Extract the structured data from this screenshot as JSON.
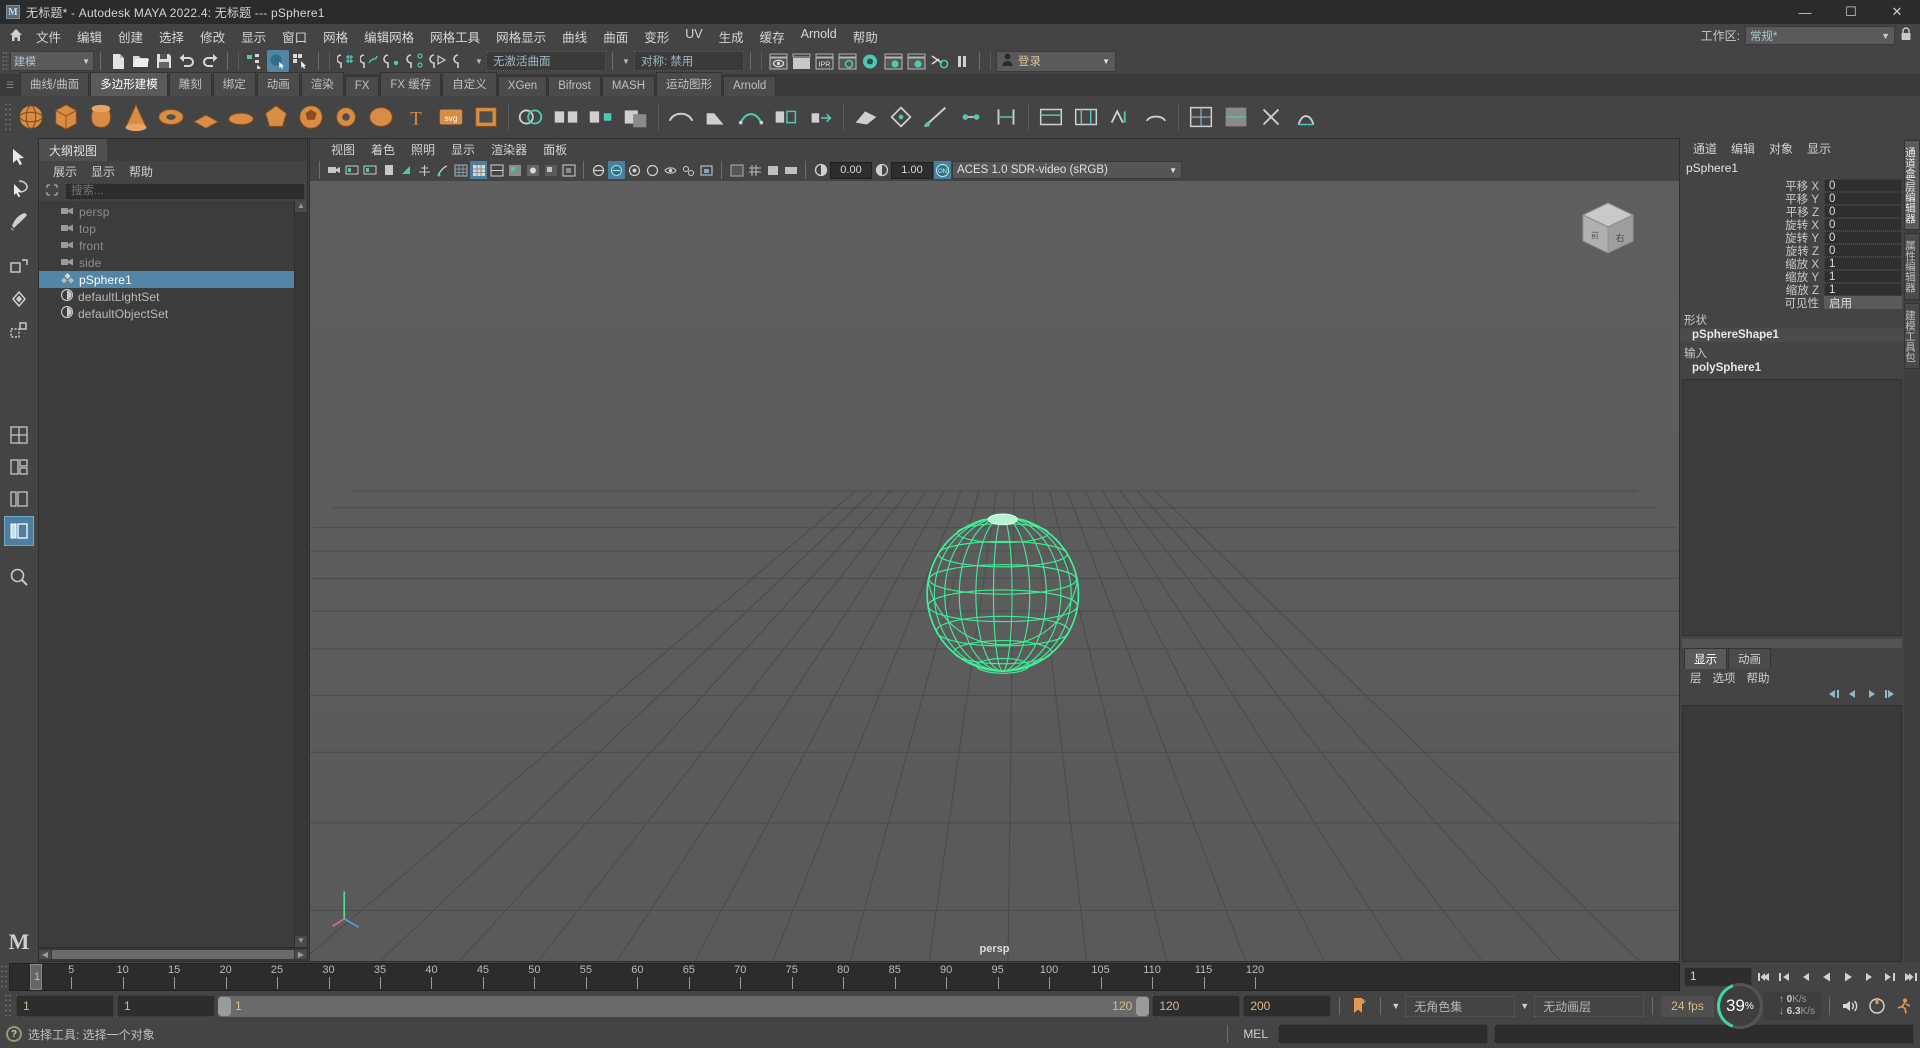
{
  "window": {
    "title": "无标题* - Autodesk MAYA 2022.4: 无标题   ---   pSphere1",
    "minimize": "—",
    "maximize": "☐",
    "close": "✕",
    "app_icon": "maya-logo-icon"
  },
  "menubar": {
    "home_icon": "home-icon",
    "items": [
      "文件",
      "编辑",
      "创建",
      "选择",
      "修改",
      "显示",
      "窗口",
      "网格",
      "编辑网格",
      "网格工具",
      "网格显示",
      "曲线",
      "曲面",
      "变形",
      "UV",
      "生成",
      "缓存",
      "Arnold",
      "帮助"
    ],
    "workspace_label": "工作区:",
    "workspace_value": "常规*",
    "lock_icon": "lock-icon"
  },
  "statusline": {
    "mode_value": "建模",
    "surface_field": "无激活曲面",
    "symmetry_field": "对称: 禁用",
    "login_label": "登录",
    "icons": [
      "new-file-icon",
      "open-file-icon",
      "save-file-icon",
      "undo-icon",
      "redo-icon",
      "select-hierarchy-icon",
      "select-object-icon",
      "select-component-icon",
      "snap-grid-icon",
      "snap-curve-icon",
      "snap-point-icon",
      "snap-projected-icon",
      "snap-view-plane-icon",
      "render-view-icon",
      "render-region-icon",
      "ipr-icon",
      "render-settings-icon",
      "hypershade-icon",
      "render-setup-icon",
      "light-editor-icon",
      "toggle-render-icon",
      "pause-icon",
      "user-avatar-icon"
    ]
  },
  "shelf": {
    "tabs": [
      "曲线/曲面",
      "多边形建模",
      "雕刻",
      "绑定",
      "动画",
      "渲染",
      "FX",
      "FX 缓存",
      "自定义",
      "XGen",
      "Bifrost",
      "MASH",
      "运动图形",
      "Arnold"
    ],
    "active_tab": "多边形建模",
    "icon_names": [
      "poly-sphere",
      "poly-cube",
      "poly-cylinder",
      "poly-cone",
      "poly-torus",
      "poly-plane",
      "poly-disc",
      "poly-platonic",
      "poly-soccer-ball",
      "poly-gear",
      "poly-super-ellipse",
      "poly-type",
      "poly-svg",
      "poly-pipe",
      "combine",
      "separate",
      "extract",
      "booleans",
      "smooth",
      "bevel",
      "bridge",
      "append-poly",
      "extrude",
      "wedge",
      "poke",
      "multi-cut",
      "target-weld",
      "connect",
      "offset-edge-loop",
      "insert-edge-loop",
      "slide-edge",
      "crease",
      "uv-editor",
      "uv-mapping",
      "uv-cut",
      "uv-sew"
    ]
  },
  "toolbox": {
    "items": [
      "select-tool",
      "lasso-select-tool",
      "paint-select-tool",
      "move-tool",
      "rotate-tool",
      "scale-tool",
      "soft-select-tool",
      "last-tool",
      "layout-single-icon",
      "layout-two-pane-icon",
      "layout-three-pane-icon",
      "outliner-persp-layout-icon",
      "hypergraph-layout-icon"
    ],
    "active": "outliner-persp-layout-icon",
    "logo": "maya-M-logo"
  },
  "outliner": {
    "title": "大纲视图",
    "menus": [
      "展示",
      "显示",
      "帮助"
    ],
    "search_icon": "filter-icon",
    "search_placeholder": "搜索...",
    "items": [
      {
        "name": "persp",
        "icon": "camera-icon",
        "selected": false,
        "dim": true
      },
      {
        "name": "top",
        "icon": "camera-icon",
        "selected": false,
        "dim": true
      },
      {
        "name": "front",
        "icon": "camera-icon",
        "selected": false,
        "dim": true
      },
      {
        "name": "side",
        "icon": "camera-icon",
        "selected": false,
        "dim": true
      },
      {
        "name": "pSphere1",
        "icon": "transform-icon",
        "selected": true,
        "dim": false
      },
      {
        "name": "defaultLightSet",
        "icon": "set-icon",
        "selected": false,
        "dim": false
      },
      {
        "name": "defaultObjectSet",
        "icon": "set-icon",
        "selected": false,
        "dim": false
      }
    ]
  },
  "viewport": {
    "menus": [
      "视图",
      "着色",
      "照明",
      "显示",
      "渲染器",
      "面板"
    ],
    "exposure_value": "0.00",
    "gamma_value": "1.00",
    "colorspace": "ACES 1.0 SDR-video (sRGB)",
    "camera_label": "persp",
    "view_cube_icon": "view-cube-icon",
    "axis_gizmo_icon": "axis-gizmo-icon",
    "object": {
      "type": "sphere-wireframe",
      "selected": true,
      "wire_color": "#3ff29a",
      "highlight_color": "#b6f2d2"
    },
    "grid_color": "#4a4a4a",
    "bg_color": "#5d5d5d"
  },
  "channelbox": {
    "menus": [
      "通道",
      "编辑",
      "对象",
      "显示"
    ],
    "object_name": "pSphere1",
    "attributes": [
      {
        "label": "平移 X",
        "value": "0",
        "grey": false
      },
      {
        "label": "平移 Y",
        "value": "0",
        "grey": false
      },
      {
        "label": "平移 Z",
        "value": "0",
        "grey": false
      },
      {
        "label": "旋转 X",
        "value": "0",
        "grey": false
      },
      {
        "label": "旋转 Y",
        "value": "0",
        "grey": false
      },
      {
        "label": "旋转 Z",
        "value": "0",
        "grey": false
      },
      {
        "label": "缩放 X",
        "value": "1",
        "grey": false
      },
      {
        "label": "缩放 Y",
        "value": "1",
        "grey": false
      },
      {
        "label": "缩放 Z",
        "value": "1",
        "grey": false
      },
      {
        "label": "可见性",
        "value": "启用",
        "grey": true
      }
    ],
    "shape_label": "形状",
    "shape_value": "pSphereShape1",
    "input_label": "输入",
    "input_value": "polySphere1",
    "side_tabs": [
      "通道盒/层编辑器",
      "属性编辑器",
      "建模工具包"
    ],
    "side_tab_active": "通道盒/层编辑器"
  },
  "layers": {
    "tabs": [
      "显示",
      "动画"
    ],
    "active_tab": "显示",
    "menus": [
      "层",
      "选项",
      "帮助"
    ],
    "icons": [
      "layer-first-icon",
      "layer-prev-icon",
      "layer-next-icon",
      "layer-new-icon"
    ]
  },
  "timeline": {
    "current_frame": "1",
    "ticks": [
      5,
      10,
      15,
      20,
      25,
      30,
      35,
      40,
      45,
      50,
      55,
      60,
      65,
      70,
      75,
      80,
      85,
      90,
      95,
      100,
      105,
      110,
      115,
      120
    ],
    "range_start": 1,
    "range_end": 120,
    "frame_field": "1",
    "playback_icons": [
      "go-to-start-icon",
      "step-back-key-icon",
      "step-back-frame-icon",
      "play-backwards-icon",
      "play-forwards-icon",
      "step-forward-frame-icon",
      "step-forward-key-icon",
      "go-to-end-icon"
    ]
  },
  "rangeslider": {
    "anim_start": "1",
    "range_start": "1",
    "slider_start_label": "1",
    "slider_end_label": "120",
    "range_end": "120",
    "anim_end": "200",
    "key_icon": "auto-keyframe-icon",
    "character_set": "无角色集",
    "animation_layer": "无动画层",
    "fps": "24 fps",
    "audio_icon": "speaker-icon",
    "anim_prefs_icon": "animation-prefs-icon",
    "run_icon": "run-up-icon"
  },
  "performance": {
    "percent": "39",
    "percent_unit": "%",
    "upload": "0",
    "download": "6.3",
    "unit": "K/s"
  },
  "statusbar": {
    "help_icon": "help-icon",
    "message": "选择工具: 选择一个对象",
    "mel_label": "MEL",
    "mel_input": "",
    "mel_output": ""
  },
  "colors": {
    "accent_blue": "#5285a6",
    "shelf_orange": "#d98c43",
    "teal": "#4ec8b5",
    "wire_green": "#3ff29a",
    "text": "#d0d0d0"
  }
}
